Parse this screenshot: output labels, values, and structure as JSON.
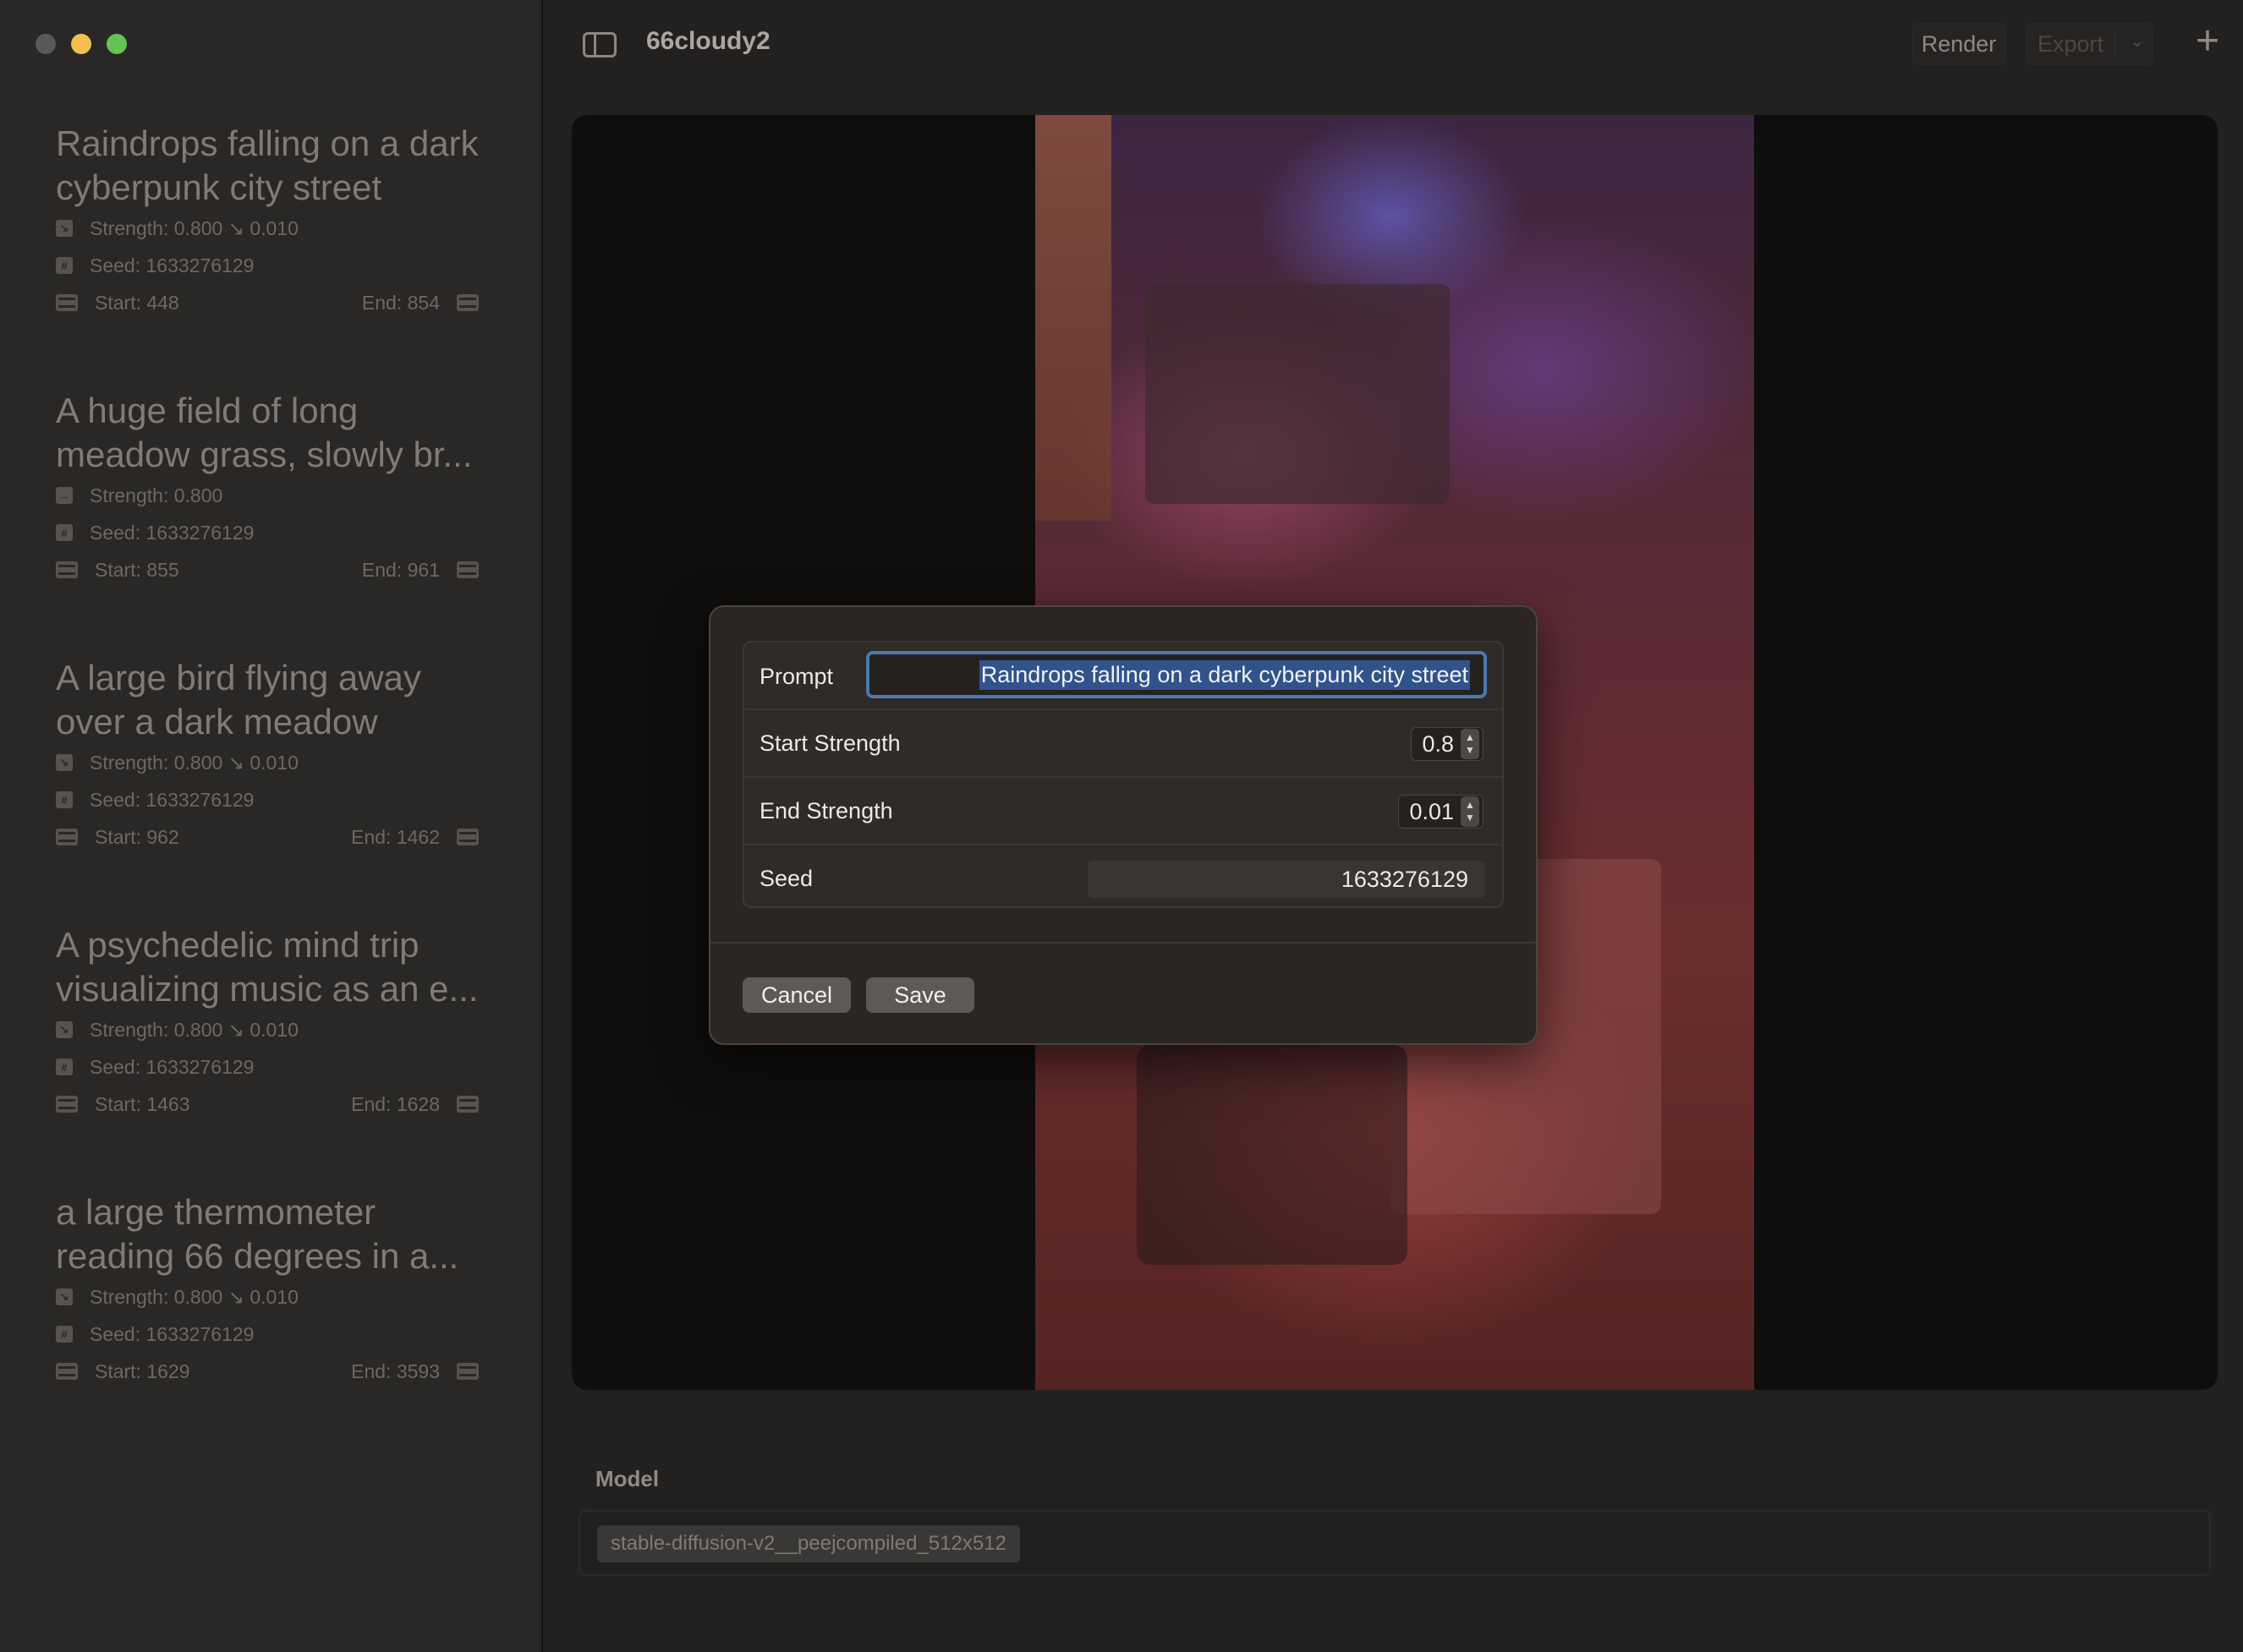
{
  "window": {
    "title": "66cloudy2"
  },
  "toolbar": {
    "render_label": "Render",
    "export_label": "Export",
    "export_chevron": "⌄",
    "plus_label": "+"
  },
  "sidebar": {
    "segments": [
      {
        "title": "Raindrops falling on a dark cyberpunk city street",
        "strength": "Strength: 0.800 ↘ 0.010",
        "seed": "Seed: 1633276129",
        "start": "Start: 448",
        "end": "End: 854"
      },
      {
        "title": "A huge field of long meadow grass, slowly br...",
        "strength": "Strength: 0.800",
        "seed": "Seed: 1633276129",
        "start": "Start: 855",
        "end": "End: 961"
      },
      {
        "title": "A large bird flying away over a dark  meadow",
        "strength": "Strength: 0.800 ↘ 0.010",
        "seed": "Seed: 1633276129",
        "start": "Start: 962",
        "end": "End: 1462"
      },
      {
        "title": "A psychedelic mind trip visualizing music as an e...",
        "strength": "Strength: 0.800 ↘ 0.010",
        "seed": "Seed: 1633276129",
        "start": "Start: 1463",
        "end": "End: 1628"
      },
      {
        "title": "a large thermometer reading 66 degrees in a...",
        "strength": "Strength: 0.800 ↘ 0.010",
        "seed": "Seed: 1633276129",
        "start": "Start: 1629",
        "end": "End: 3593"
      }
    ]
  },
  "model": {
    "label": "Model",
    "value": "stable-diffusion-v2__peejcompiled_512x512"
  },
  "dialog": {
    "prompt_label": "Prompt",
    "prompt_value": "Raindrops falling on a dark cyberpunk city street",
    "start_strength_label": "Start Strength",
    "start_strength_value": "0.8",
    "end_strength_label": "End Strength",
    "end_strength_value": "0.01",
    "seed_label": "Seed",
    "seed_value": "1633276129",
    "cancel_label": "Cancel",
    "save_label": "Save"
  },
  "colors": {
    "accent_focus": "#4a79b3",
    "selection": "#31538b",
    "traffic_min": "#f5bf4f",
    "traffic_max": "#61c554"
  },
  "icons": {
    "strength": "strength-icon",
    "seed": "seed-icon",
    "start": "film-icon",
    "end": "film-icon"
  }
}
